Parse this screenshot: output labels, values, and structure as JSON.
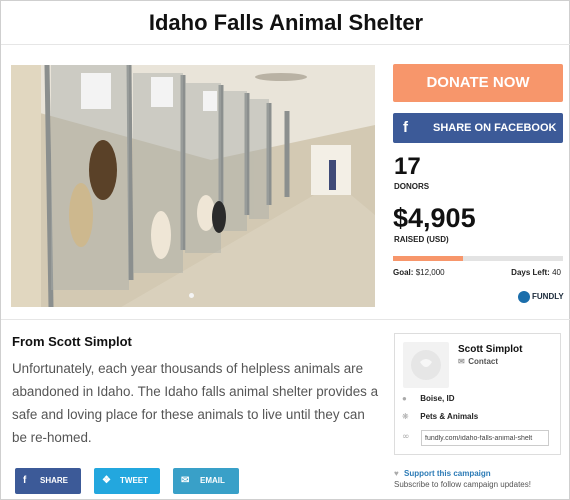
{
  "page": {
    "title": "Idaho Falls Animal Shelter"
  },
  "campaign": {
    "donate_label": "DONATE NOW",
    "facebook_label": "SHARE ON FACEBOOK",
    "donors_count": "17",
    "donors_label": "DONORS",
    "raised_amount": "$4,905",
    "raised_label": "RAISED (USD)",
    "progress_fraction": 0.41,
    "goal_label": "Goal:",
    "goal_value": "$12,000",
    "days_left_label": "Days Left:",
    "days_left_value": "40",
    "brand": "FUNDLY"
  },
  "story": {
    "from": "From Scott Simplot",
    "text": "Unfortunately, each year thousands of helpless animals are abandoned in Idaho. The Idaho falls animal shelter provides a safe and loving place for these animals to live until they can be re-homed."
  },
  "share": {
    "share_label": "SHARE",
    "tweet_label": "TWEET",
    "email_label": "EMAIL"
  },
  "organizer": {
    "name": "Scott Simplot",
    "contact_label": "Contact",
    "location": "Boise, ID",
    "category": "Pets & Animals",
    "url": "fundly.com/idaho-falls-animal-shelt"
  },
  "support": {
    "link_label": "Support this campaign",
    "subscribe_text": "Subscribe to follow campaign updates!"
  },
  "colors": {
    "donate": "#f7966b",
    "facebook": "#3c5a98",
    "twitter": "#23a7de",
    "email": "#39a0c8",
    "link": "#2c7bb6"
  }
}
